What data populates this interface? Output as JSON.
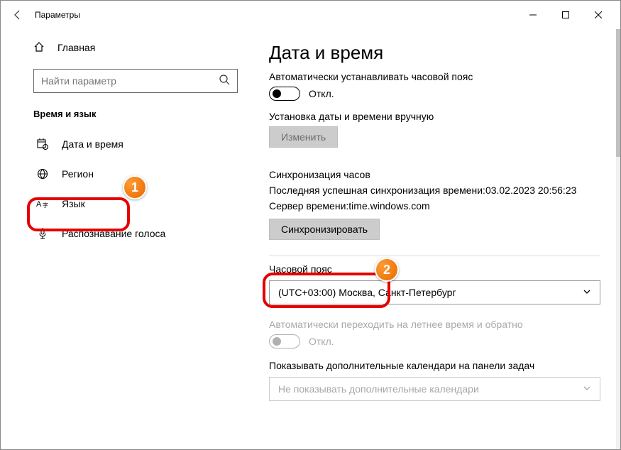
{
  "window": {
    "title": "Параметры"
  },
  "sidebar": {
    "home": "Главная",
    "search_placeholder": "Найти параметр",
    "section": "Время и язык",
    "items": [
      {
        "label": "Дата и время"
      },
      {
        "label": "Регион"
      },
      {
        "label": "Язык"
      },
      {
        "label": "Распознавание голоса"
      }
    ]
  },
  "page": {
    "title": "Дата и время",
    "auto_tz_label": "Автоматически устанавливать часовой пояс",
    "auto_tz_state": "Откл.",
    "manual_label": "Установка даты и времени вручную",
    "change_btn": "Изменить",
    "sync_header": "Синхронизация часов",
    "last_sync_prefix": "Последняя успешная синхронизация времени:",
    "last_sync_value": "03.02.2023 20:56:23",
    "server_prefix": "Сервер времени:",
    "server_value": "time.windows.com",
    "sync_btn": "Синхронизировать",
    "tz_header": "Часовой пояс",
    "tz_value": "(UTC+03:00) Москва, Санкт-Петербург",
    "dst_label": "Автоматически переходить на летнее время и обратно",
    "dst_state": "Откл.",
    "extra_cal_label": "Показывать дополнительные календари на панели задач",
    "extra_cal_value": "Не показывать дополнительные календари"
  },
  "annotations": {
    "badge1": "1",
    "badge2": "2"
  }
}
